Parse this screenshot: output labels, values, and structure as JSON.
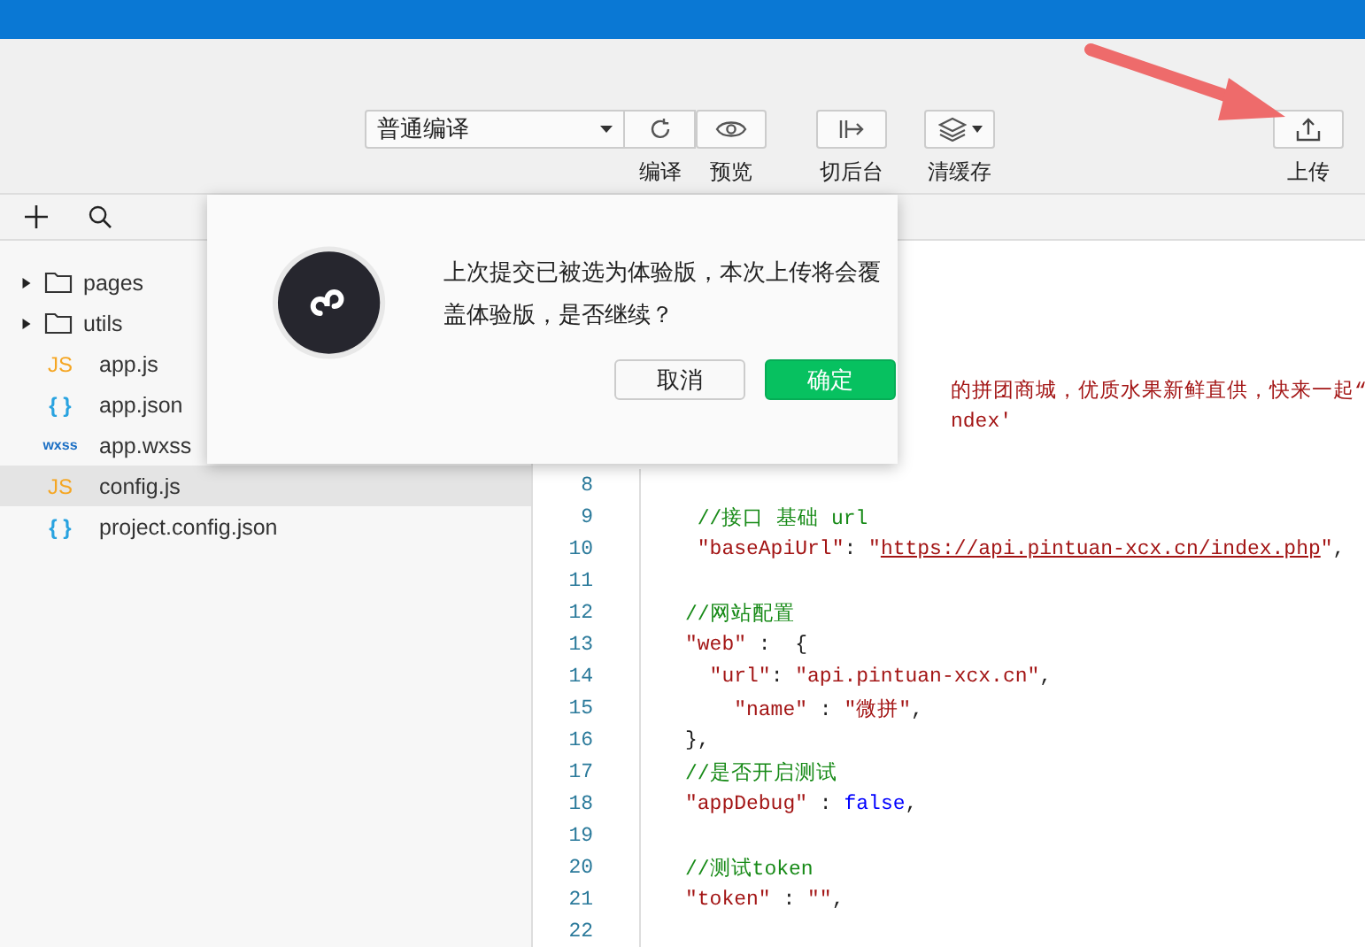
{
  "toolbar": {
    "compile_select": {
      "value": "普通编译"
    },
    "tools": [
      {
        "kind": "refresh",
        "label": "编译"
      },
      {
        "kind": "preview",
        "label": "预览"
      },
      {
        "kind": "background",
        "label": "切后台"
      },
      {
        "kind": "cache",
        "label": "清缓存"
      },
      {
        "kind": "upload",
        "label": "上传"
      }
    ]
  },
  "sidebar": {
    "items": [
      {
        "kind": "folder",
        "name": "pages",
        "expanded": false,
        "selected": false
      },
      {
        "kind": "folder",
        "name": "utils",
        "expanded": false,
        "selected": false
      },
      {
        "kind": "js",
        "icon": "JS",
        "name": "app.js",
        "selected": false
      },
      {
        "kind": "json",
        "icon": "{ }",
        "name": "app.json",
        "selected": false
      },
      {
        "kind": "wxss",
        "icon": "wxss",
        "name": "app.wxss",
        "selected": false
      },
      {
        "kind": "js",
        "icon": "JS",
        "name": "config.js",
        "selected": true
      },
      {
        "kind": "json",
        "icon": "{ }",
        "name": "project.config.json",
        "selected": false
      }
    ]
  },
  "editor": {
    "lines": [
      {
        "kind": "covered",
        "segments": [
          {
            "kind": "string",
            "text": "的拼团商城，优质水果新鲜直供，快来一起“"
          }
        ]
      },
      {
        "kind": "covered",
        "segments": [
          {
            "kind": "string",
            "text": "ndex'"
          }
        ]
      },
      {
        "kind": "code",
        "number": "8"
      },
      {
        "kind": "code",
        "number": "9",
        "segments": [
          {
            "kind": "comment",
            "text": " //接口 基础 url"
          }
        ]
      },
      {
        "kind": "code",
        "number": "10",
        "segments": [
          {
            "kind": "string",
            "text": " \"baseApiUrl\""
          },
          {
            "kind": "punct",
            "text": ": "
          },
          {
            "kind": "string",
            "text": "\""
          },
          {
            "kind": "link",
            "text": "https://api.pintuan-xcx.cn/index.php"
          },
          {
            "kind": "string",
            "text": "\""
          },
          {
            "kind": "punct",
            "text": ","
          }
        ]
      },
      {
        "kind": "code",
        "number": "11"
      },
      {
        "kind": "code",
        "number": "12",
        "segments": [
          {
            "kind": "comment",
            "text": "//网站配置"
          }
        ]
      },
      {
        "kind": "code",
        "number": "13",
        "segments": [
          {
            "kind": "string",
            "text": "\"web\""
          },
          {
            "kind": "punct",
            "text": " :  {"
          }
        ]
      },
      {
        "kind": "code",
        "number": "14",
        "segments": [
          {
            "kind": "string",
            "text": "  \"url\""
          },
          {
            "kind": "punct",
            "text": ": "
          },
          {
            "kind": "string",
            "text": "\"api.pintuan-xcx.cn\""
          },
          {
            "kind": "punct",
            "text": ","
          }
        ]
      },
      {
        "kind": "code",
        "number": "15",
        "segments": [
          {
            "kind": "string",
            "text": "    \"name\""
          },
          {
            "kind": "punct",
            "text": " : "
          },
          {
            "kind": "string",
            "text": "\"微拼\""
          },
          {
            "kind": "punct",
            "text": ","
          }
        ]
      },
      {
        "kind": "code",
        "number": "16",
        "segments": [
          {
            "kind": "punct",
            "text": "},"
          }
        ]
      },
      {
        "kind": "code",
        "number": "17",
        "segments": [
          {
            "kind": "comment",
            "text": "//是否开启测试"
          }
        ]
      },
      {
        "kind": "code",
        "number": "18",
        "segments": [
          {
            "kind": "string",
            "text": "\"appDebug\""
          },
          {
            "kind": "punct",
            "text": " : "
          },
          {
            "kind": "keyword",
            "text": "false"
          },
          {
            "kind": "punct",
            "text": ","
          }
        ]
      },
      {
        "kind": "code",
        "number": "19"
      },
      {
        "kind": "code",
        "number": "20",
        "segments": [
          {
            "kind": "comment",
            "text": "//测试token"
          }
        ]
      },
      {
        "kind": "code",
        "number": "21",
        "segments": [
          {
            "kind": "string",
            "text": "\"token\""
          },
          {
            "kind": "punct",
            "text": " : "
          },
          {
            "kind": "string",
            "text": "\"\""
          },
          {
            "kind": "punct",
            "text": ","
          }
        ]
      },
      {
        "kind": "code",
        "number": "22"
      }
    ]
  },
  "dialog": {
    "message": "上次提交已被选为体验版，本次上传将会覆盖体验版，是否继续？",
    "buttons": [
      {
        "kind": "secondary",
        "label": "取消"
      },
      {
        "kind": "primary",
        "label": "确定"
      }
    ]
  }
}
